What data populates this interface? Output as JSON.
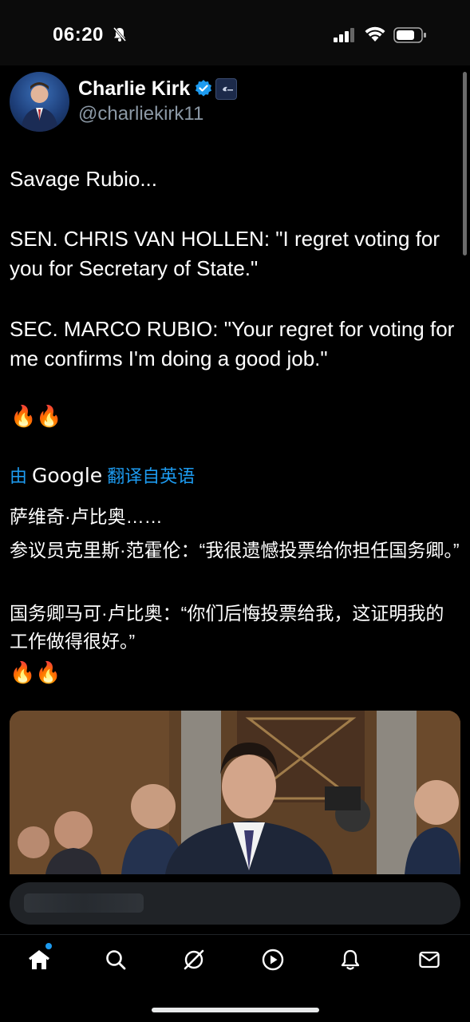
{
  "status_bar": {
    "time": "06:20"
  },
  "author": {
    "display_name": "Charlie Kirk",
    "handle": "@charliekirk11"
  },
  "tweet": {
    "line1": "Savage Rubio...",
    "line2": "SEN. CHRIS VAN HOLLEN: \"I regret voting for you for Secretary of State.\"",
    "line3": "SEC. MARCO RUBIO: \"Your regret for voting for me confirms I'm doing a good job.\"",
    "emoji": "🔥🔥"
  },
  "translation": {
    "prefix": "由",
    "google": "Google",
    "suffix": "翻译自英语",
    "line1": "萨维奇·卢比奥……",
    "line2": "参议员克里斯·范霍伦：“我很遗憾投票给你担任国务卿。”",
    "line3": "国务卿马可·卢比奥：“你们后悔投票给我，这证明我的工作做得很好。”",
    "emoji": "🔥🔥"
  },
  "nav": {
    "items": [
      "home-icon",
      "search-icon",
      "grok-icon",
      "video-icon",
      "notifications-icon",
      "messages-icon"
    ]
  },
  "colors": {
    "accent": "#1d9bf0",
    "background": "#000000",
    "text": "#e7e9ea",
    "muted": "#8b98a5"
  }
}
